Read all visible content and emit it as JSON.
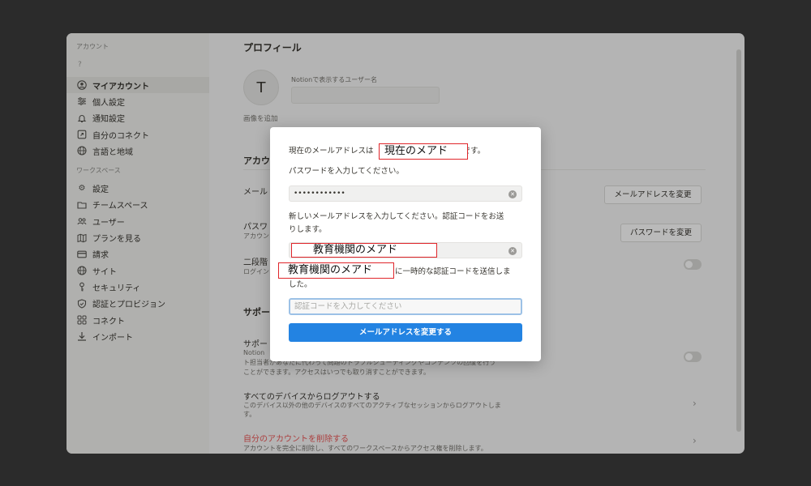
{
  "sidebar": {
    "account_heading": "アカウント",
    "user_placeholder": "?",
    "account_items": [
      {
        "label": "マイアカウント",
        "icon": "user-circle-icon"
      },
      {
        "label": "個人設定",
        "icon": "sliders-icon"
      },
      {
        "label": "通知設定",
        "icon": "bell-icon"
      },
      {
        "label": "自分のコネクト",
        "icon": "external-link-icon"
      },
      {
        "label": "言語と地域",
        "icon": "globe-icon"
      }
    ],
    "workspace_heading": "ワークスペース",
    "workspace_items": [
      {
        "label": "設定",
        "icon": "gear-icon"
      },
      {
        "label": "チームスペース",
        "icon": "folder-icon"
      },
      {
        "label": "ユーザー",
        "icon": "users-icon"
      },
      {
        "label": "プランを見る",
        "icon": "map-icon"
      },
      {
        "label": "請求",
        "icon": "credit-card-icon"
      },
      {
        "label": "サイト",
        "icon": "globe-icon"
      },
      {
        "label": "セキュリティ",
        "icon": "key-icon"
      },
      {
        "label": "認証とプロビジョン",
        "icon": "shield-icon"
      },
      {
        "label": "コネクト",
        "icon": "grid-icon"
      },
      {
        "label": "インポート",
        "icon": "download-icon"
      }
    ]
  },
  "main": {
    "profile_title": "プロフィール",
    "avatar_letter": "T",
    "display_name_label": "Notionで表示するユーザー名",
    "add_image": "画像を追加",
    "account_section": "アカウ",
    "email_row_label": "メール",
    "change_email_button": "メールアドレスを変更",
    "password_row_label": "パスワ",
    "password_row_desc": "アカウン",
    "change_password_button": "パスワードを変更",
    "two_step_label": "二段階",
    "two_step_desc": "ログイン",
    "support_section": "サポー",
    "support_access_label": "サポー",
    "support_access_desc": "Notion",
    "support_desc_line2": "ト担当者があなたに代わって問題のトラブルシューティングやコンテンツの回復を行う",
    "support_desc_line3": "ことができます。アクセスはいつでも取り消すことができます。",
    "logout_all_title": "すべてのデバイスからログアウトする",
    "logout_all_desc": "このデバイス以外の他のデバイスのすべてのアクティブなセッションからログアウトしま",
    "logout_all_desc2": "す。",
    "delete_account_title": "自分のアカウントを削除する",
    "delete_account_desc": "アカウントを完全に削除し、すべてのワークスペースからアクセス権を削除します。"
  },
  "modal": {
    "current_email_prefix": "現在のメールアドレスは",
    "current_email_redacted": "現在のメアド",
    "current_email_suffix": "です。",
    "enter_password": "パスワードを入力してください。",
    "password_value": "••••••••••••",
    "enter_new_email_line1": "新しいメールアドレスを入力してください。認証コードをお送",
    "enter_new_email_line2": "りします。",
    "new_email_redacted": "教育機関のメアド",
    "sent_redacted": "教育機関のメアド",
    "sent_suffix_line1": "に一時的な認証コードを送信しま",
    "sent_suffix_line2": "した。",
    "code_placeholder": "認証コードを入力してください",
    "submit_label": "メールアドレスを変更する"
  },
  "colors": {
    "accent": "#2383e2",
    "danger": "#e0262b",
    "delete_text": "#eb5757"
  }
}
